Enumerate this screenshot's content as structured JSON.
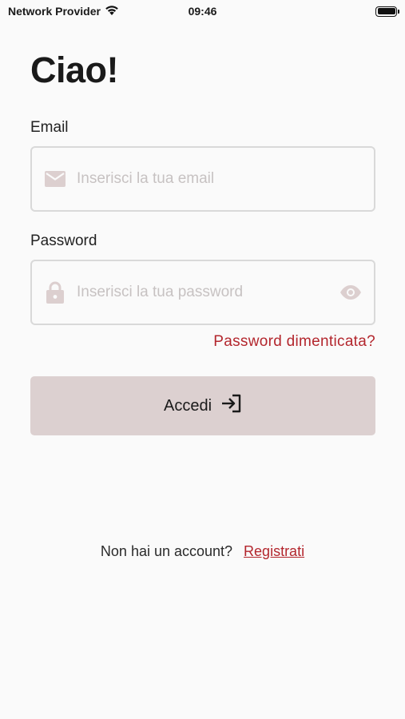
{
  "status_bar": {
    "carrier": "Network Provider",
    "time": "09:46",
    "wifi_icon": "wifi-icon",
    "battery_icon": "battery-icon"
  },
  "login": {
    "title": "Ciao!",
    "email_label": "Email",
    "email_placeholder": "Inserisci la tua email",
    "email_icon": "mail-icon",
    "password_label": "Password",
    "password_placeholder": "Inserisci la tua password",
    "password_icon": "lock-icon",
    "visibility_icon": "eye-icon",
    "forgot_password": "Password dimenticata?",
    "submit_label": "Accedi",
    "submit_icon": "login-icon"
  },
  "register": {
    "prompt": "Non hai un account?",
    "link": "Registrati"
  },
  "colors": {
    "accent": "#b3262d",
    "button_bg": "#dcd0d0",
    "icon_muted": "#dccfcf",
    "background": "#fafafa"
  }
}
